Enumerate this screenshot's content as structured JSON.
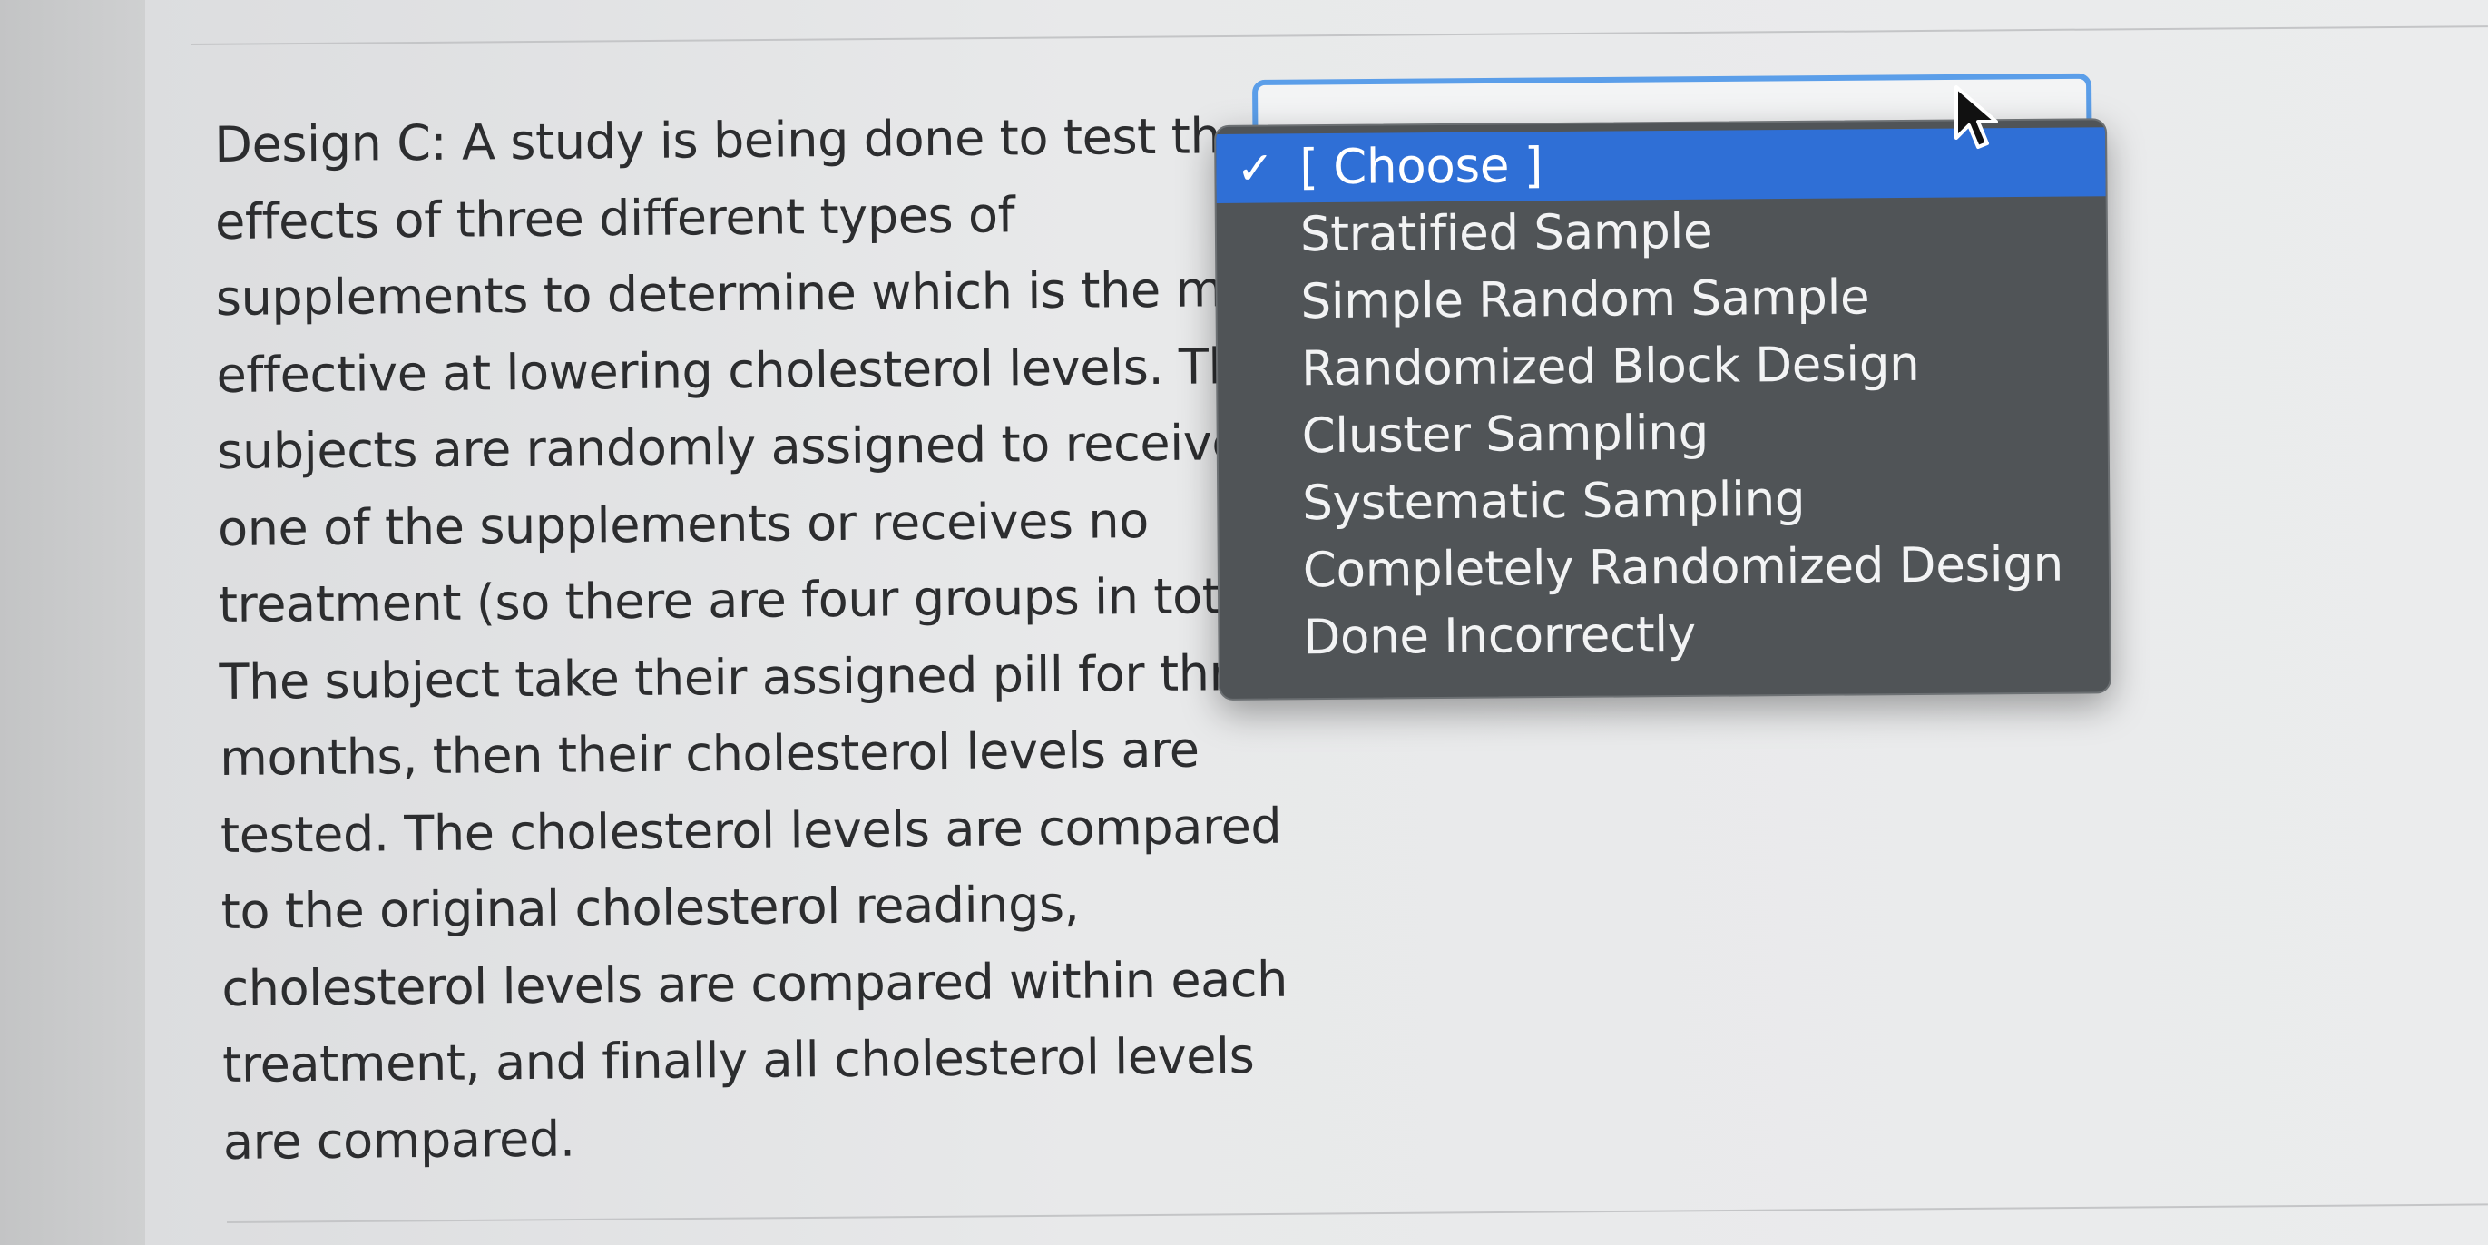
{
  "question": {
    "lines": [
      "Design C: A study is being done to test the",
      "effects of three different types of",
      "supplements to determine which is the mo",
      "effective at lowering cholesterol levels. The",
      "subjects are randomly assigned to receive",
      "one of the supplements or receives no",
      "treatment (so there are four groups in total",
      "The subject take their assigned pill for thre",
      "months, then their cholesterol levels are",
      "tested. The cholesterol levels are compared",
      "to the original cholesterol readings,",
      "cholesterol levels are compared within each",
      "treatment, and finally all cholesterol levels",
      "are compared."
    ]
  },
  "dropdown": {
    "selected_value": "[ Choose ]",
    "checkmark": "✓",
    "options": [
      "[ Choose ]",
      "Stratified Sample",
      "Simple Random Sample",
      "Randomized Block Design",
      "Cluster Sampling",
      "Systematic Sampling",
      "Completely Randomized Design",
      "Done Incorrectly"
    ],
    "colors": {
      "menu_background": "#505457",
      "highlight": "#2f6fd6",
      "focus_ring": "#5b9ee9"
    }
  },
  "cursor": {
    "icon": "arrow-pointer-icon"
  }
}
